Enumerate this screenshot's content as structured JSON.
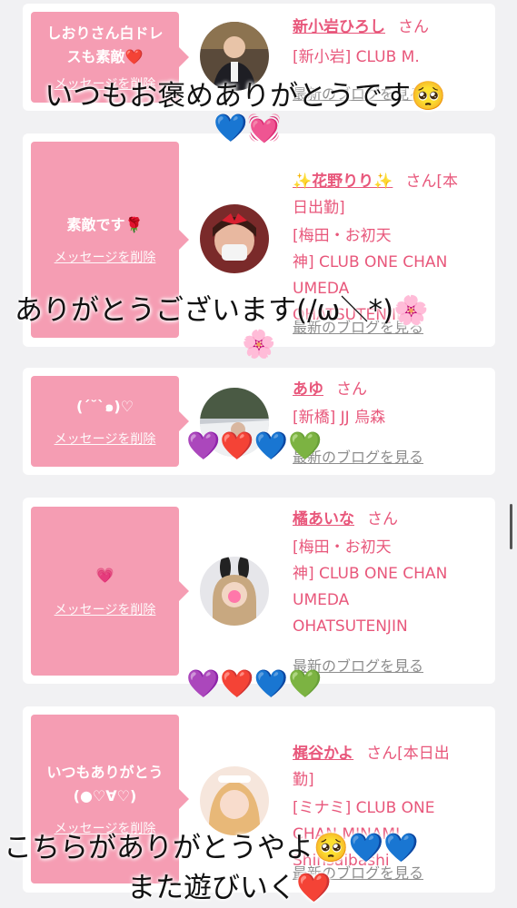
{
  "cards": [
    {
      "message": "しおりさん白ドレ\nスも素敵❤️",
      "delete_label": "メッセージを削除",
      "name": "新小岩ひろし",
      "honorific": "さん",
      "shop": "[新小岩] CLUB M.",
      "blog_label": "最新のブログを見る"
    },
    {
      "message": "素敵です🌹",
      "delete_label": "メッセージを削除",
      "name": "✨花野りり✨",
      "honorific": "さん[本\n日出勤]",
      "shop": "[梅田・お初天\n神] CLUB ONE CHAN\nUMEDA\nOHATSUTENJIN",
      "blog_label": "最新のブログを見る"
    },
    {
      "message": "(´˘`๑)♡",
      "delete_label": "メッセージを削除",
      "name": "あゆ",
      "honorific": "さん",
      "shop": "[新橋] JJ 烏森",
      "blog_label": "最新のブログを見る"
    },
    {
      "message": "💗",
      "delete_label": "メッセージを削除",
      "name": "橘あいな",
      "honorific": "さん",
      "shop": "[梅田・お初天\n神] CLUB ONE CHAN\nUMEDA\nOHATSUTENJIN",
      "blog_label": "最新のブログを見る"
    },
    {
      "message": "いつもありがとう\n(●♡∀♡)",
      "delete_label": "メッセージを削除",
      "name": "梶谷かよ",
      "honorific": "さん[本日出\n勤]",
      "shop": "[ミナミ] CLUB ONE\nCHAN MINAMI\nShinsaibashi",
      "blog_label": "最新のブログを見る"
    }
  ],
  "overlays": {
    "line1": "いつもお褒めありがとうです🥺",
    "line1_emoji": "💙💓",
    "line2": "ありがとうございます(/ω＼*)🌸",
    "line2_emoji": "🌸",
    "line3_emoji": "💜❤️💙💚",
    "line4_emoji": "💜❤️💙💚",
    "line5": "こちらがありがとうやよ🥺💙💙",
    "line6": "また遊びいく❤️"
  },
  "colors": {
    "accent_pink": "#e8577b",
    "bubble_pink": "#f59db3",
    "blog_gray": "#8d8d8d"
  }
}
